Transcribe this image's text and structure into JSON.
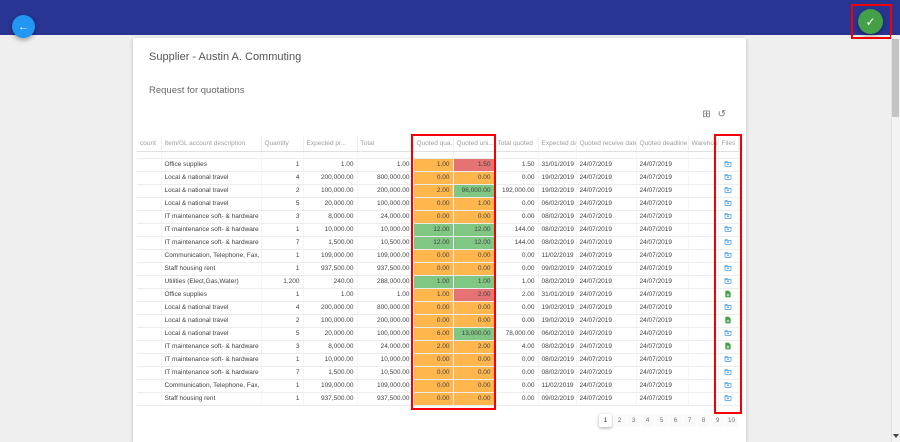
{
  "colors": {
    "appbar": "#283593",
    "back_fab": "#2196F3",
    "confirm_fab": "#43A047",
    "cell_orange": "#FFB74D",
    "cell_red": "#E57373",
    "cell_green": "#81C784",
    "file_icon_blue": "#1E88E5",
    "file_icon_green": "#43A047",
    "annotation_red": "#F40000"
  },
  "fab_back": {
    "icon": "arrow-left"
  },
  "fab_confirm": {
    "icon": "check"
  },
  "card": {
    "title": "Supplier - Austin A. Commuting"
  },
  "section": {
    "title": "Request for quotations"
  },
  "toolbar": {
    "icons": [
      "grid-icon",
      "undo-icon"
    ]
  },
  "table": {
    "columns": [
      "count",
      "Item/GL account description",
      "Quantity",
      "Expected pr...",
      "Total",
      "Quoted qua...",
      "Quoted uni...",
      "Total quoted",
      "Expected date",
      "Quoted receive date",
      "Quoted deadline",
      "Warehouse",
      "Files"
    ],
    "rows": [
      {
        "count": "",
        "description": "Office supplies",
        "quantity": "1",
        "expected_price": "1.00",
        "total": "1.00",
        "quoted_quantity": {
          "value": "1.00",
          "color": "orange"
        },
        "quoted_unit": {
          "value": "1.50",
          "color": "red"
        },
        "total_quoted": "1.50",
        "expected_date": "31/01/2019",
        "quoted_receive_date": "24/07/2019",
        "quoted_deadline": "24/07/2019",
        "warehouse": "",
        "file_icon": "open-folder-blue"
      },
      {
        "count": "",
        "description": "Local & national travel",
        "quantity": "4",
        "expected_price": "200,000.00",
        "total": "800,000.00",
        "quoted_quantity": {
          "value": "0.00",
          "color": "orange"
        },
        "quoted_unit": {
          "value": "0.00",
          "color": "orange"
        },
        "total_quoted": "0.00",
        "expected_date": "19/02/2019",
        "quoted_receive_date": "24/07/2019",
        "quoted_deadline": "24/07/2019",
        "warehouse": "",
        "file_icon": "open-folder-blue"
      },
      {
        "count": "",
        "description": "Local & national travel",
        "quantity": "2",
        "expected_price": "100,000.00",
        "total": "200,000.00",
        "quoted_quantity": {
          "value": "2.00",
          "color": "orange"
        },
        "quoted_unit": {
          "value": "96,000.00",
          "color": "green"
        },
        "total_quoted": "192,000.00",
        "expected_date": "19/02/2019",
        "quoted_receive_date": "24/07/2019",
        "quoted_deadline": "24/07/2019",
        "warehouse": "",
        "file_icon": "open-folder-blue"
      },
      {
        "count": "",
        "description": "Local & national travel",
        "quantity": "5",
        "expected_price": "20,000.00",
        "total": "100,000.00",
        "quoted_quantity": {
          "value": "0.00",
          "color": "orange"
        },
        "quoted_unit": {
          "value": "1.00",
          "color": "orange"
        },
        "total_quoted": "0.00",
        "expected_date": "06/02/2019",
        "quoted_receive_date": "24/07/2019",
        "quoted_deadline": "24/07/2019",
        "warehouse": "",
        "file_icon": "open-folder-blue"
      },
      {
        "count": "",
        "description": "IT maintenance soft- & hardware",
        "quantity": "3",
        "expected_price": "8,000.00",
        "total": "24,000.00",
        "quoted_quantity": {
          "value": "0.00",
          "color": "orange"
        },
        "quoted_unit": {
          "value": "0.00",
          "color": "orange"
        },
        "total_quoted": "0.00",
        "expected_date": "08/02/2019",
        "quoted_receive_date": "24/07/2019",
        "quoted_deadline": "24/07/2019",
        "warehouse": "",
        "file_icon": "open-folder-blue"
      },
      {
        "count": "",
        "description": "IT maintenance soft- & hardware",
        "quantity": "1",
        "expected_price": "10,000.00",
        "total": "10,000.00",
        "quoted_quantity": {
          "value": "12.00",
          "color": "green"
        },
        "quoted_unit": {
          "value": "12.00",
          "color": "green"
        },
        "total_quoted": "144.00",
        "expected_date": "08/02/2019",
        "quoted_receive_date": "24/07/2019",
        "quoted_deadline": "24/07/2019",
        "warehouse": "",
        "file_icon": "open-folder-blue"
      },
      {
        "count": "",
        "description": "IT maintenance soft- & hardware",
        "quantity": "7",
        "expected_price": "1,500.00",
        "total": "10,500.00",
        "quoted_quantity": {
          "value": "12.00",
          "color": "green"
        },
        "quoted_unit": {
          "value": "12.00",
          "color": "green"
        },
        "total_quoted": "144.00",
        "expected_date": "08/02/2019",
        "quoted_receive_date": "24/07/2019",
        "quoted_deadline": "24/07/2019",
        "warehouse": "",
        "file_icon": "open-folder-blue"
      },
      {
        "count": "",
        "description": "Communication, Telephone, Fax, Int.",
        "quantity": "1",
        "expected_price": "109,000.00",
        "total": "109,000.00",
        "quoted_quantity": {
          "value": "0.00",
          "color": "orange"
        },
        "quoted_unit": {
          "value": "0.00",
          "color": "orange"
        },
        "total_quoted": "0.00",
        "expected_date": "11/02/2019",
        "quoted_receive_date": "24/07/2019",
        "quoted_deadline": "24/07/2019",
        "warehouse": "",
        "file_icon": "open-folder-blue"
      },
      {
        "count": "",
        "description": "Staff housing rent",
        "quantity": "1",
        "expected_price": "937,500.00",
        "total": "937,500.00",
        "quoted_quantity": {
          "value": "0.00",
          "color": "orange"
        },
        "quoted_unit": {
          "value": "0.00",
          "color": "orange"
        },
        "total_quoted": "0.00",
        "expected_date": "09/02/2019",
        "quoted_receive_date": "24/07/2019",
        "quoted_deadline": "24/07/2019",
        "warehouse": "",
        "file_icon": "open-folder-blue"
      },
      {
        "count": "",
        "description": "Utilities (Elect,Gas,Water)",
        "quantity": "1,200",
        "expected_price": "240.00",
        "total": "288,000.00",
        "quoted_quantity": {
          "value": "1.00",
          "color": "green"
        },
        "quoted_unit": {
          "value": "1.00",
          "color": "green"
        },
        "total_quoted": "1.00",
        "expected_date": "08/02/2019",
        "quoted_receive_date": "24/07/2019",
        "quoted_deadline": "24/07/2019",
        "warehouse": "",
        "file_icon": "open-folder-blue"
      },
      {
        "count": "",
        "description": "Office supplies",
        "quantity": "1",
        "expected_price": "1.00",
        "total": "1.00",
        "quoted_quantity": {
          "value": "1.00",
          "color": "orange"
        },
        "quoted_unit": {
          "value": "2.00",
          "color": "red"
        },
        "total_quoted": "2.00",
        "expected_date": "31/01/2019",
        "quoted_receive_date": "24/07/2019",
        "quoted_deadline": "24/07/2019",
        "warehouse": "",
        "file_icon": "add-file-green"
      },
      {
        "count": "",
        "description": "Local & national travel",
        "quantity": "4",
        "expected_price": "200,000.00",
        "total": "800,000.00",
        "quoted_quantity": {
          "value": "0.00",
          "color": "orange"
        },
        "quoted_unit": {
          "value": "0.00",
          "color": "orange"
        },
        "total_quoted": "0.00",
        "expected_date": "19/02/2019",
        "quoted_receive_date": "24/07/2019",
        "quoted_deadline": "24/07/2019",
        "warehouse": "",
        "file_icon": "open-folder-blue"
      },
      {
        "count": "",
        "description": "Local & national travel",
        "quantity": "2",
        "expected_price": "100,000.00",
        "total": "200,000.00",
        "quoted_quantity": {
          "value": "0.00",
          "color": "orange"
        },
        "quoted_unit": {
          "value": "0.00",
          "color": "orange"
        },
        "total_quoted": "0.00",
        "expected_date": "19/02/2019",
        "quoted_receive_date": "24/07/2019",
        "quoted_deadline": "24/07/2019",
        "warehouse": "",
        "file_icon": "add-file-green"
      },
      {
        "count": "",
        "description": "Local & national travel",
        "quantity": "5",
        "expected_price": "20,000.00",
        "total": "100,000.00",
        "quoted_quantity": {
          "value": "6.00",
          "color": "orange"
        },
        "quoted_unit": {
          "value": "13,000.00",
          "color": "green"
        },
        "total_quoted": "78,000.00",
        "expected_date": "06/02/2019",
        "quoted_receive_date": "24/07/2019",
        "quoted_deadline": "24/07/2019",
        "warehouse": "",
        "file_icon": "open-folder-blue"
      },
      {
        "count": "",
        "description": "IT maintenance soft- & hardware",
        "quantity": "3",
        "expected_price": "8,000.00",
        "total": "24,000.00",
        "quoted_quantity": {
          "value": "2.00",
          "color": "orange"
        },
        "quoted_unit": {
          "value": "2.00",
          "color": "orange"
        },
        "total_quoted": "4.00",
        "expected_date": "08/02/2019",
        "quoted_receive_date": "24/07/2019",
        "quoted_deadline": "24/07/2019",
        "warehouse": "",
        "file_icon": "add-file-green"
      },
      {
        "count": "",
        "description": "IT maintenance soft- & hardware",
        "quantity": "1",
        "expected_price": "10,000.00",
        "total": "10,000.00",
        "quoted_quantity": {
          "value": "0.00",
          "color": "orange"
        },
        "quoted_unit": {
          "value": "0.00",
          "color": "orange"
        },
        "total_quoted": "0.00",
        "expected_date": "08/02/2019",
        "quoted_receive_date": "24/07/2019",
        "quoted_deadline": "24/07/2019",
        "warehouse": "",
        "file_icon": "open-folder-blue"
      },
      {
        "count": "",
        "description": "IT maintenance soft- & hardware",
        "quantity": "7",
        "expected_price": "1,500.00",
        "total": "10,500.00",
        "quoted_quantity": {
          "value": "0.00",
          "color": "orange"
        },
        "quoted_unit": {
          "value": "0.00",
          "color": "orange"
        },
        "total_quoted": "0.00",
        "expected_date": "08/02/2019",
        "quoted_receive_date": "24/07/2019",
        "quoted_deadline": "24/07/2019",
        "warehouse": "",
        "file_icon": "open-folder-blue"
      },
      {
        "count": "",
        "description": "Communication, Telephone, Fax, Int.",
        "quantity": "1",
        "expected_price": "109,000.00",
        "total": "109,000.00",
        "quoted_quantity": {
          "value": "0.00",
          "color": "orange"
        },
        "quoted_unit": {
          "value": "0.00",
          "color": "orange"
        },
        "total_quoted": "0.00",
        "expected_date": "11/02/2019",
        "quoted_receive_date": "24/07/2019",
        "quoted_deadline": "24/07/2019",
        "warehouse": "",
        "file_icon": "open-folder-blue"
      },
      {
        "count": "",
        "description": "Staff housing rent",
        "quantity": "1",
        "expected_price": "937,500.00",
        "total": "937,500.00",
        "quoted_quantity": {
          "value": "0.00",
          "color": "orange"
        },
        "quoted_unit": {
          "value": "0.00",
          "color": "orange"
        },
        "total_quoted": "0.00",
        "expected_date": "09/02/2019",
        "quoted_receive_date": "24/07/2019",
        "quoted_deadline": "24/07/2019",
        "warehouse": "",
        "file_icon": "open-folder-blue"
      }
    ]
  },
  "pagination": {
    "pages": [
      "1",
      "2",
      "3",
      "4",
      "5",
      "6",
      "7",
      "8",
      "9",
      "10"
    ],
    "active": "1"
  }
}
